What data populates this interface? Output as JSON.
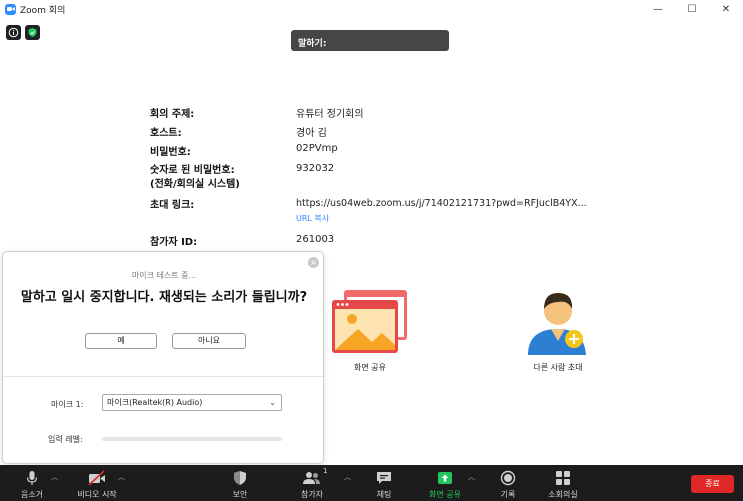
{
  "window": {
    "title": "Zoom 회의",
    "minimize": "—",
    "maximize": "☐",
    "close": "✕"
  },
  "speaking_banner": "말하기:",
  "meeting_info": {
    "topic_label": "회의 주제:",
    "topic": "유튜터 정기회의",
    "host_label": "호스트:",
    "host": "경아 김",
    "password_label": "비밀번호:",
    "password": "02PVmp",
    "numeric_password_label": "숫자로 된 비밀번호:",
    "numeric_password_label2": "(전화/회의실 시스템)",
    "numeric_password": "932032",
    "invite_link_label": "초대 링크:",
    "invite_link": "https://us04web.zoom.us/j/71402121731?pwd=RFJuclB4YX...",
    "copy_url": "URL 복사",
    "participant_id_label": "참가자 ID:",
    "participant_id": "261003"
  },
  "tiles": {
    "share_screen": "화면 공유",
    "invite_others": "다른 사람 초대"
  },
  "mic_test": {
    "close": "×",
    "subtitle": "마이크 테스트 중...",
    "question": "말하고 일시 중지합니다. 재생되는 소리가 들립니까?",
    "yes": "예",
    "no": "아니요",
    "mic_label": "마이크 1:",
    "mic_value": "마이크(Realtek(R) Audio)",
    "input_level_label": "입력 레벨:",
    "input_level": 0
  },
  "toolbar": {
    "mute": "음소거",
    "start_video": "비디오 시작",
    "security": "보안",
    "participants": "참가자",
    "participants_count": "1",
    "chat": "채팅",
    "share_screen": "화면 공유",
    "record": "기록",
    "breakout_rooms": "소회의실",
    "end": "종료"
  },
  "colors": {
    "accent": "#2d8cff",
    "share_green": "#22c55e",
    "end_red": "#e02828",
    "toolbar_bg": "#1c1c1c"
  }
}
